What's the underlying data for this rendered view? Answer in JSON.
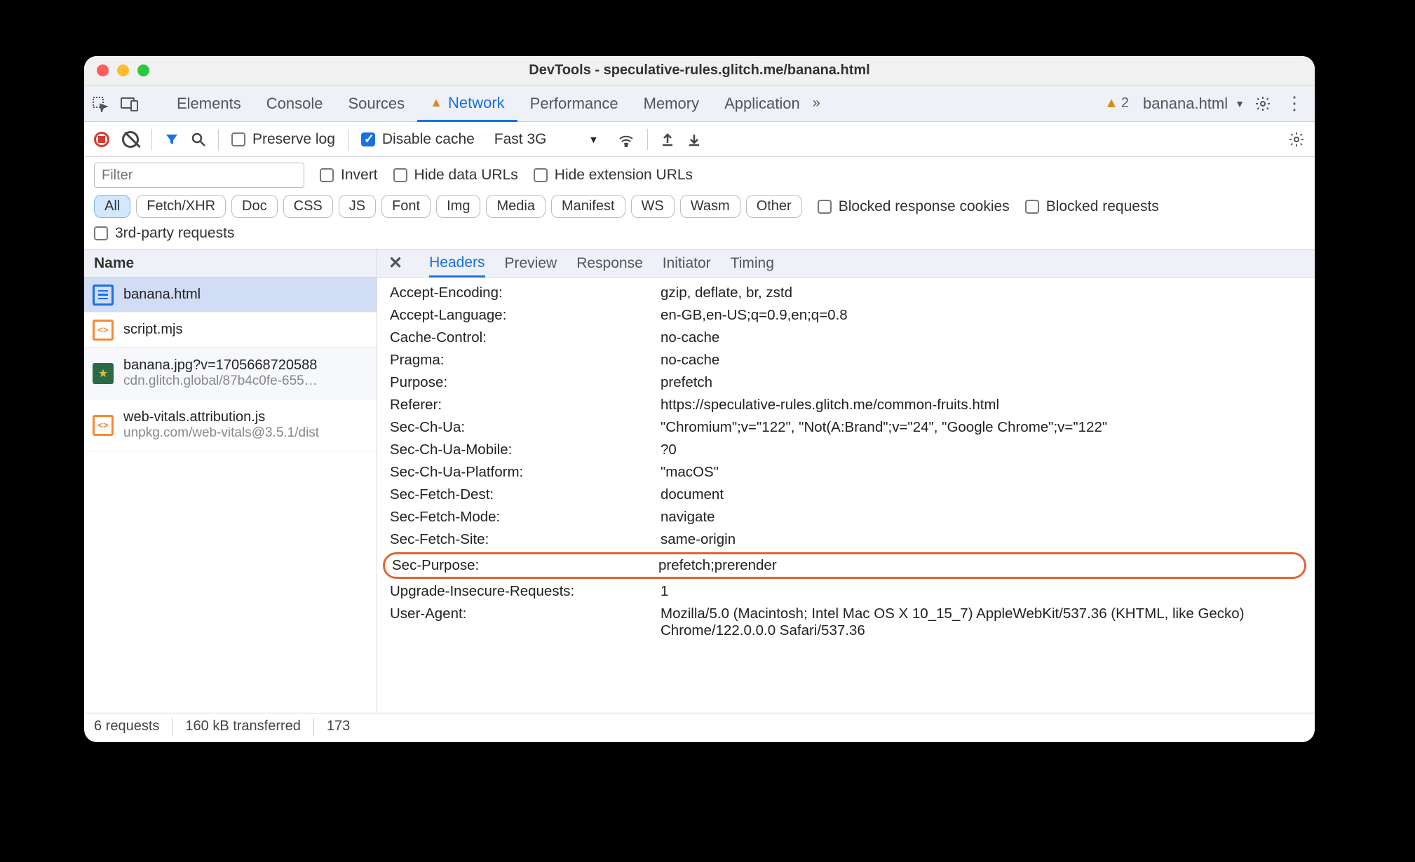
{
  "window": {
    "title": "DevTools - speculative-rules.glitch.me/banana.html"
  },
  "tabs": {
    "items": [
      "Elements",
      "Console",
      "Sources",
      "Network",
      "Performance",
      "Memory",
      "Application"
    ],
    "active": "Network",
    "network_has_warning": true,
    "warning_count": "2",
    "context": "banana.html"
  },
  "toolbar": {
    "preserve_log": "Preserve log",
    "disable_cache": "Disable cache",
    "throttling": "Fast 3G"
  },
  "filter": {
    "placeholder": "Filter",
    "invert": "Invert",
    "hide_data_urls": "Hide data URLs",
    "hide_extension_urls": "Hide extension URLs",
    "types": [
      "All",
      "Fetch/XHR",
      "Doc",
      "CSS",
      "JS",
      "Font",
      "Img",
      "Media",
      "Manifest",
      "WS",
      "Wasm",
      "Other"
    ],
    "active_type": "All",
    "blocked_cookies": "Blocked response cookies",
    "blocked_requests": "Blocked requests",
    "third_party": "3rd-party requests"
  },
  "sidebar": {
    "header": "Name",
    "requests": [
      {
        "name": "banana.html",
        "sub": "",
        "icon": "doc",
        "selected": true,
        "alt": false
      },
      {
        "name": "script.mjs",
        "sub": "",
        "icon": "js",
        "selected": false,
        "alt": false
      },
      {
        "name": "banana.jpg?v=1705668720588",
        "sub": "cdn.glitch.global/87b4c0fe-655…",
        "icon": "img",
        "selected": false,
        "alt": true
      },
      {
        "name": "web-vitals.attribution.js",
        "sub": "unpkg.com/web-vitals@3.5.1/dist",
        "icon": "js",
        "selected": false,
        "alt": false
      }
    ]
  },
  "detail": {
    "tabs": [
      "Headers",
      "Preview",
      "Response",
      "Initiator",
      "Timing"
    ],
    "active": "Headers",
    "headers": [
      {
        "k": "Accept-Encoding:",
        "v": "gzip, deflate, br, zstd"
      },
      {
        "k": "Accept-Language:",
        "v": "en-GB,en-US;q=0.9,en;q=0.8"
      },
      {
        "k": "Cache-Control:",
        "v": "no-cache"
      },
      {
        "k": "Pragma:",
        "v": "no-cache"
      },
      {
        "k": "Purpose:",
        "v": "prefetch"
      },
      {
        "k": "Referer:",
        "v": "https://speculative-rules.glitch.me/common-fruits.html"
      },
      {
        "k": "Sec-Ch-Ua:",
        "v": "\"Chromium\";v=\"122\", \"Not(A:Brand\";v=\"24\", \"Google Chrome\";v=\"122\""
      },
      {
        "k": "Sec-Ch-Ua-Mobile:",
        "v": "?0"
      },
      {
        "k": "Sec-Ch-Ua-Platform:",
        "v": "\"macOS\""
      },
      {
        "k": "Sec-Fetch-Dest:",
        "v": "document"
      },
      {
        "k": "Sec-Fetch-Mode:",
        "v": "navigate"
      },
      {
        "k": "Sec-Fetch-Site:",
        "v": "same-origin"
      },
      {
        "k": "Sec-Purpose:",
        "v": "prefetch;prerender",
        "highlight": true
      },
      {
        "k": "Upgrade-Insecure-Requests:",
        "v": "1"
      },
      {
        "k": "User-Agent:",
        "v": "Mozilla/5.0 (Macintosh; Intel Mac OS X 10_15_7) AppleWebKit/537.36 (KHTML, like Gecko) Chrome/122.0.0.0 Safari/537.36"
      }
    ]
  },
  "status": {
    "requests": "6 requests",
    "transferred": "160 kB transferred",
    "resources": "173"
  }
}
